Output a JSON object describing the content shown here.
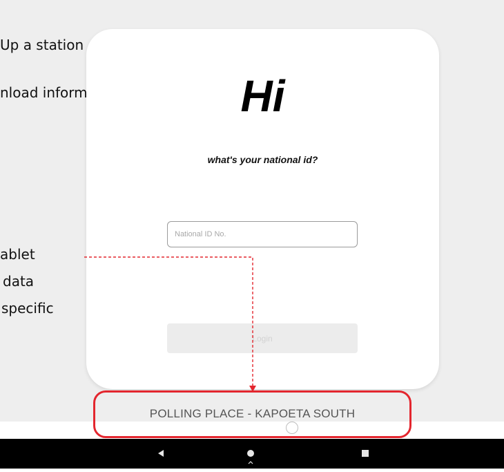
{
  "slide_text": {
    "line1": "Up a station",
    "line2": "nload information",
    "line3": "ablet",
    "line4": "data",
    "line5": "specific"
  },
  "login_screen": {
    "greeting": "Hi",
    "question": "what's your national id?",
    "id_placeholder": "National ID No.",
    "login_label": "Login"
  },
  "footer": {
    "polling_place": "POLLING PLACE - KAPOETA SOUTH"
  },
  "nav_bar": {
    "back_icon": "back-icon",
    "home_icon": "home-icon",
    "recents_icon": "recents-icon"
  },
  "colors": {
    "highlight": "#e3262e",
    "annotation_line": "#e3262e",
    "nav_bar": "#000000"
  }
}
